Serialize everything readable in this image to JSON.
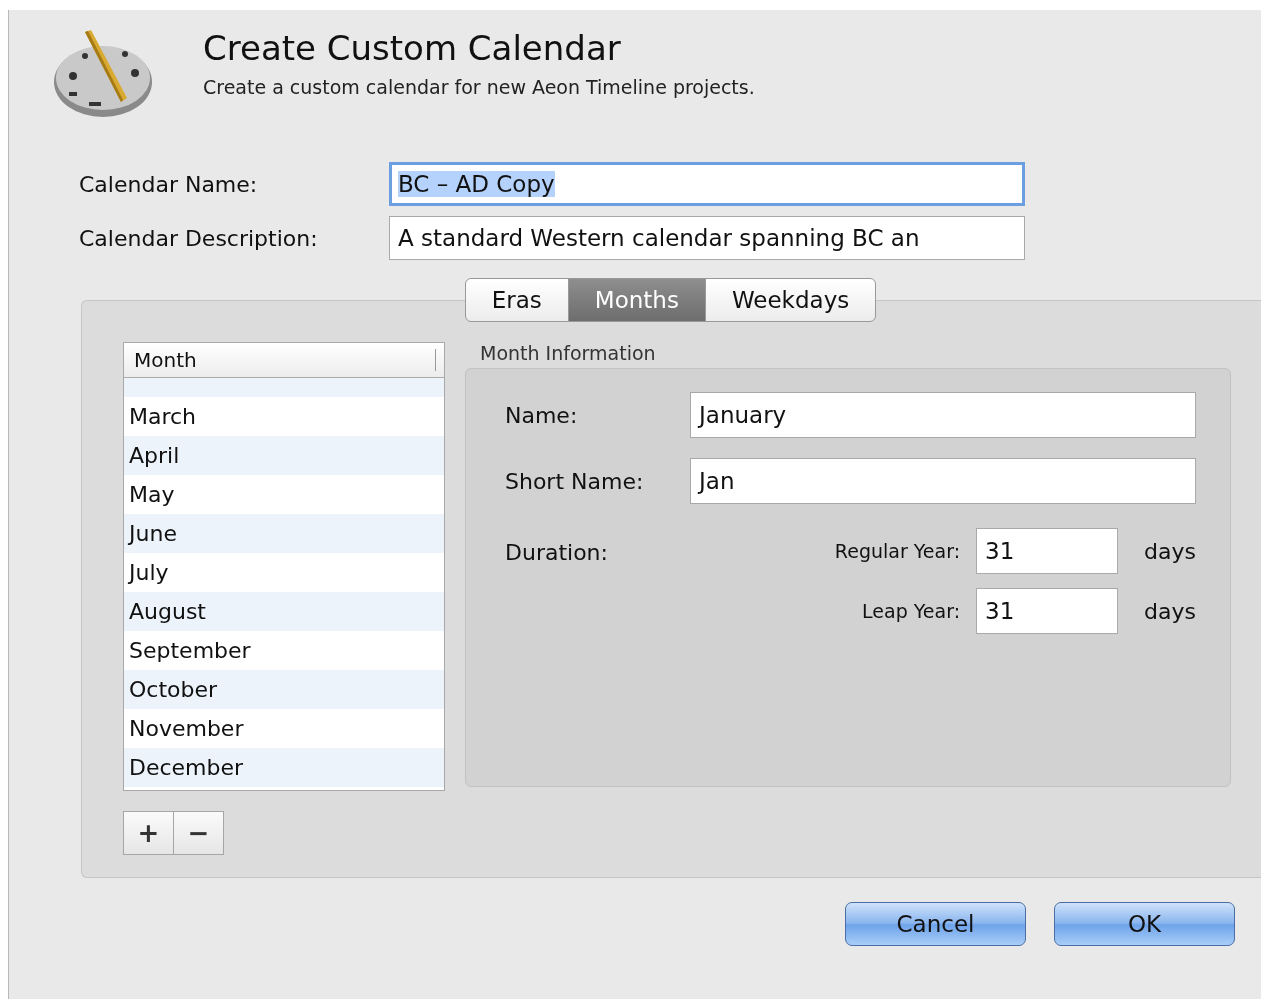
{
  "dialog": {
    "title": "Create Custom Calendar",
    "subtitle": "Create a custom calendar for new Aeon Timeline projects."
  },
  "fields": [
    {
      "label": "Calendar Name:",
      "value": "BC – AD Copy",
      "focused": true,
      "text_selected": true
    },
    {
      "label": "Calendar Description:",
      "value": "A standard Western calendar spanning BC an",
      "focused": false,
      "text_selected": false
    }
  ],
  "tabs": [
    {
      "label": "Eras",
      "selected": false
    },
    {
      "label": "Months",
      "selected": true
    },
    {
      "label": "Weekdays",
      "selected": false
    }
  ],
  "month_list": {
    "header": "Month",
    "rows": [
      "March",
      "April",
      "May",
      "June",
      "July",
      "August",
      "September",
      "October",
      "November",
      "December"
    ],
    "add_button": "+",
    "remove_button": "−"
  },
  "month_info": {
    "title": "Month Information",
    "name_label": "Name:",
    "name_value": "January",
    "short_name_label": "Short Name:",
    "short_name_value": "Jan",
    "duration_label": "Duration:",
    "durations": [
      {
        "label": "Regular Year:",
        "value": "31",
        "unit": "days"
      },
      {
        "label": "Leap Year:",
        "value": "31",
        "unit": "days"
      }
    ]
  },
  "buttons": [
    "Cancel",
    "OK"
  ]
}
